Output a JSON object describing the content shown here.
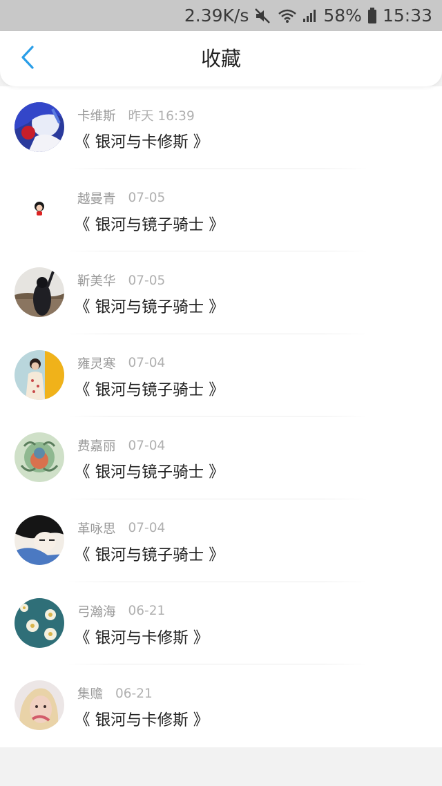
{
  "status_bar": {
    "speed": "2.39K/s",
    "battery": "58%",
    "time": "15:33",
    "icons": [
      "mute-icon",
      "wifi-icon",
      "signal-icon",
      "battery-icon"
    ]
  },
  "header": {
    "title": "收藏",
    "back_icon": "chevron-left-icon",
    "accent": "#2a9ee8"
  },
  "favorites": [
    {
      "user": "卡维斯",
      "date": "昨天 16:39",
      "book": "《 银河与卡修斯 》",
      "avatar": "avatar-anime-blue"
    },
    {
      "user": "越曼青",
      "date": "07-05",
      "book": "《 银河与镜子骑士 》",
      "avatar": "avatar-small-doll"
    },
    {
      "user": "靳美华",
      "date": "07-05",
      "book": "《 银河与镜子骑士 》",
      "avatar": "avatar-girl-back"
    },
    {
      "user": "雍灵寒",
      "date": "07-04",
      "book": "《 银河与镜子骑士 》",
      "avatar": "avatar-girl-yellow"
    },
    {
      "user": "费嘉丽",
      "date": "07-04",
      "book": "《 银河与镜子骑士 》",
      "avatar": "avatar-pattern-green"
    },
    {
      "user": "革咏思",
      "date": "07-04",
      "book": "《 银河与镜子骑士 》",
      "avatar": "avatar-anime-boy"
    },
    {
      "user": "弓瀚海",
      "date": "06-21",
      "book": "《 银河与卡修斯 》",
      "avatar": "avatar-flowers-teal"
    },
    {
      "user": "集赡",
      "date": "06-21",
      "book": "《 银河与卡修斯 》",
      "avatar": "avatar-blonde-girl"
    }
  ]
}
